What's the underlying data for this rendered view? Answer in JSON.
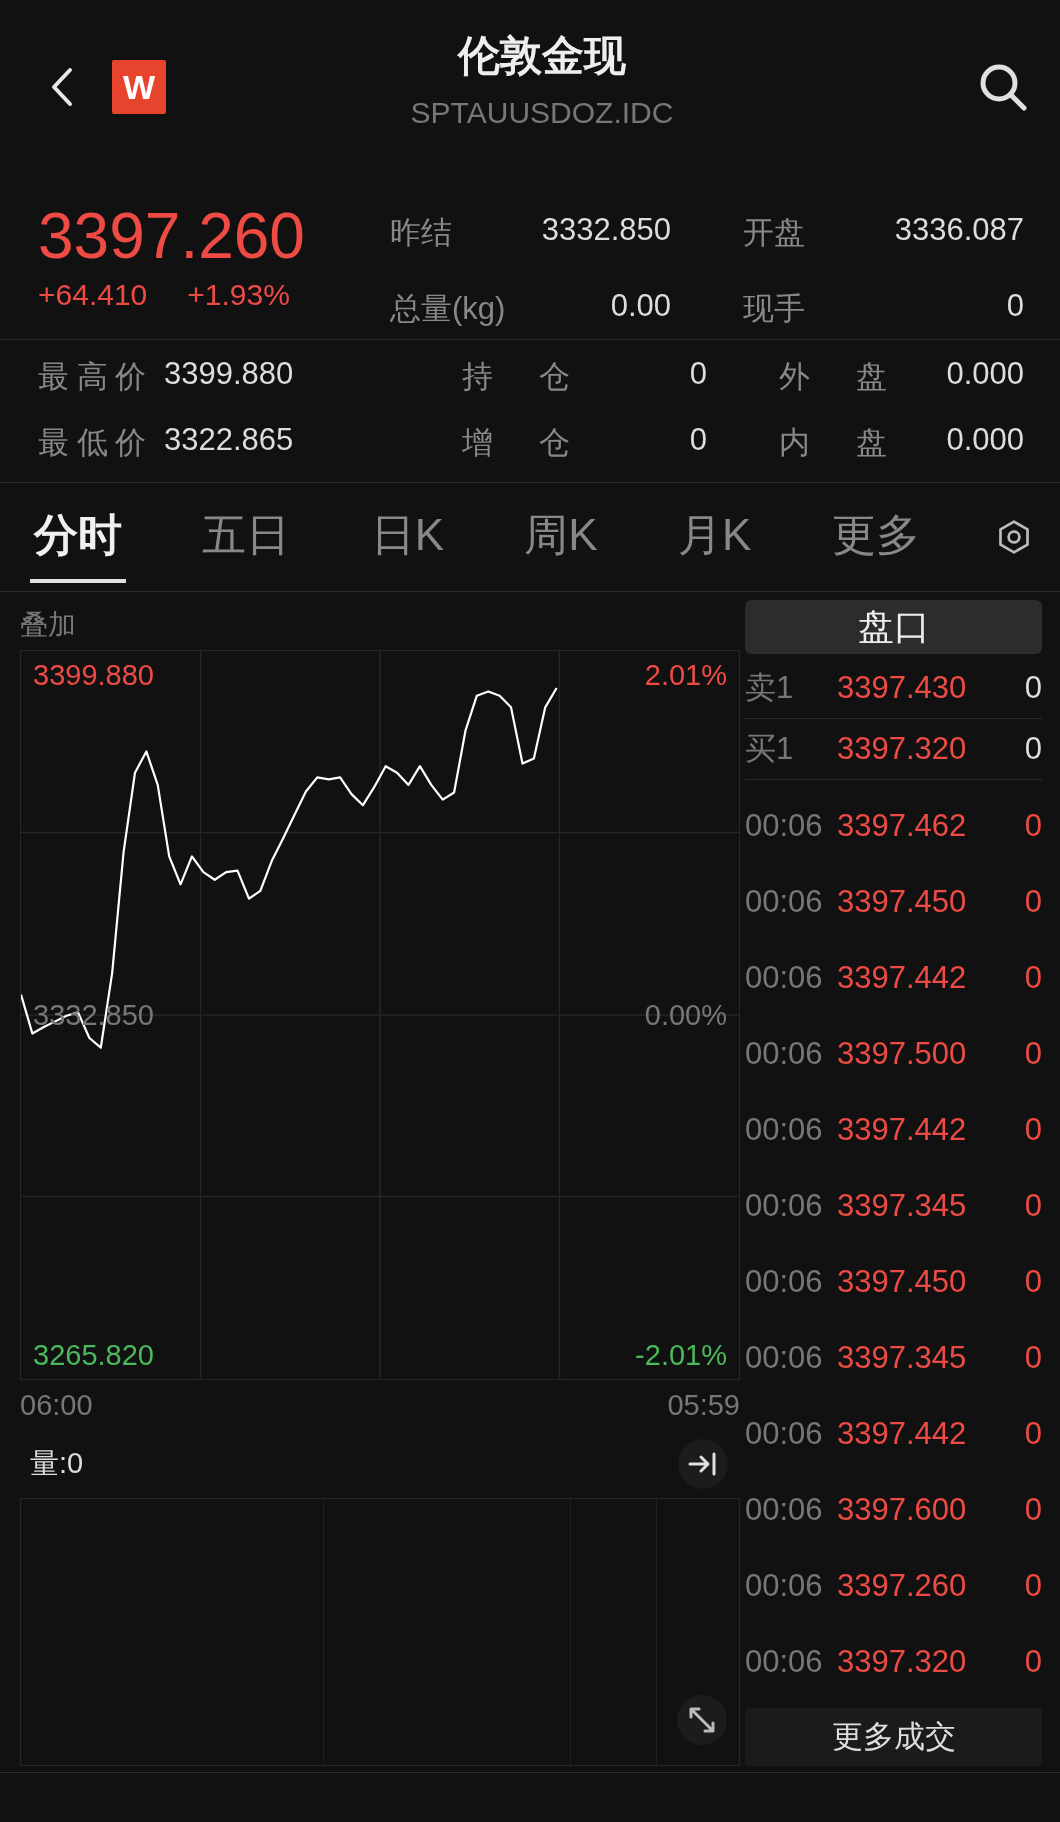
{
  "header": {
    "badge": "W",
    "title": "伦敦金现",
    "subtitle": "SPTAUUSDOZ.IDC"
  },
  "quote": {
    "price": "3397.260",
    "change": "+64.410",
    "change_pct": "+1.93%",
    "color": "#ee4b45"
  },
  "summary": [
    {
      "label": "昨结",
      "value": "3332.850"
    },
    {
      "label": "开盘",
      "value": "3336.087"
    },
    {
      "label": "总量(kg)",
      "value": "0.00"
    },
    {
      "label": "现手",
      "value": "0"
    }
  ],
  "details": [
    {
      "label": "最高价",
      "value": "3399.880"
    },
    {
      "label": "持仓",
      "value": "0"
    },
    {
      "label": "外盘",
      "value": "0.000"
    },
    {
      "label": "最低价",
      "value": "3322.865"
    },
    {
      "label": "增仓",
      "value": "0"
    },
    {
      "label": "内盘",
      "value": "0.000"
    }
  ],
  "tabs": [
    {
      "label": "分时",
      "selected": true
    },
    {
      "label": "五日",
      "selected": false
    },
    {
      "label": "日K",
      "selected": false
    },
    {
      "label": "周K",
      "selected": false
    },
    {
      "label": "月K",
      "selected": false
    },
    {
      "label": "更多",
      "selected": false
    }
  ],
  "chart": {
    "overlay": "叠加",
    "percent_labels": [
      {
        "text": "2.01%",
        "color": "#ee4b45"
      },
      {
        "text": "0.00%",
        "color": "#777777"
      },
      {
        "text": "-2.01%",
        "color": "#4cb85c"
      }
    ],
    "start_time": "06:00",
    "end_time": "05:59",
    "volume_label": "量:0",
    "chart_data": {
      "type": "line",
      "ylim": [
        3261.1,
        3404.6
      ],
      "yticks": [
        {
          "value": 3399.88,
          "label": "3399.880"
        },
        {
          "value": 3332.85,
          "label": "3332.850"
        },
        {
          "value": 3265.82,
          "label": "3265.820"
        }
      ],
      "series": [
        {
          "color": "#ffffff",
          "values": [
            3336.9,
            3329.2,
            3330.5,
            3331.6,
            3332.7,
            3333.4,
            3328.3,
            3326.4,
            3341.1,
            3365.0,
            3380.6,
            3384.8,
            3378.2,
            3364.1,
            3358.6,
            3364.1,
            3361.0,
            3359.5,
            3361.0,
            3361.3,
            3355.8,
            3357.3,
            3363.2,
            3367.7,
            3372.3,
            3376.9,
            3379.7,
            3379.3,
            3379.7,
            3376.4,
            3374.2,
            3377.8,
            3381.9,
            3380.6,
            3378.2,
            3381.9,
            3378.2,
            3375.3,
            3376.7,
            3388.9,
            3395.8,
            3396.6,
            3395.8,
            3393.5,
            3382.4,
            3383.4,
            3393.5,
            3397.3,
            null,
            null,
            null,
            null,
            null,
            null,
            null,
            null,
            null,
            null,
            null,
            null,
            null,
            null,
            null,
            null
          ]
        }
      ]
    }
  },
  "order_book": {
    "button": "盘口",
    "quotes": [
      {
        "label": "卖1",
        "price": "3397.430",
        "volume": "0"
      },
      {
        "label": "买1",
        "price": "3397.320",
        "volume": "0"
      }
    ],
    "trades": [
      {
        "time": "00:06",
        "price": "3397.462",
        "volume": "0"
      },
      {
        "time": "00:06",
        "price": "3397.450",
        "volume": "0"
      },
      {
        "time": "00:06",
        "price": "3397.442",
        "volume": "0"
      },
      {
        "time": "00:06",
        "price": "3397.500",
        "volume": "0"
      },
      {
        "time": "00:06",
        "price": "3397.442",
        "volume": "0"
      },
      {
        "time": "00:06",
        "price": "3397.345",
        "volume": "0"
      },
      {
        "time": "00:06",
        "price": "3397.450",
        "volume": "0"
      },
      {
        "time": "00:06",
        "price": "3397.345",
        "volume": "0"
      },
      {
        "time": "00:06",
        "price": "3397.442",
        "volume": "0"
      },
      {
        "time": "00:06",
        "price": "3397.600",
        "volume": "0"
      },
      {
        "time": "00:06",
        "price": "3397.260",
        "volume": "0"
      },
      {
        "time": "00:06",
        "price": "3397.320",
        "volume": "0"
      }
    ],
    "more": "更多成交"
  }
}
